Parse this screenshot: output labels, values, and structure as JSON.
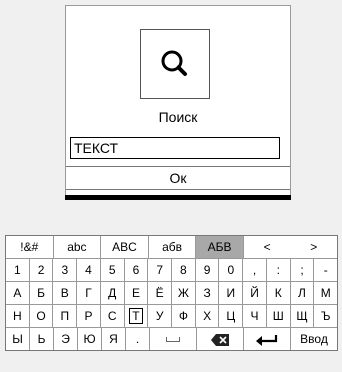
{
  "dialog": {
    "title": "Поиск",
    "input_value": "ТЕКСТ",
    "ok_label": "Ок",
    "icon": "search-icon"
  },
  "keyboard": {
    "modes": [
      "!&#",
      "abc",
      "ABC",
      "абв",
      "АБВ",
      "<",
      ">"
    ],
    "active_mode": "АБВ",
    "row1": [
      "1",
      "2",
      "3",
      "4",
      "5",
      "6",
      "7",
      "8",
      "9",
      "0",
      ",",
      ":",
      ";",
      "-"
    ],
    "row2": [
      "А",
      "Б",
      "В",
      "Г",
      "Д",
      "Е",
      "Ё",
      "Ж",
      "З",
      "И",
      "Й",
      "К",
      "Л",
      "М"
    ],
    "row3": [
      "Н",
      "О",
      "П",
      "Р",
      "С",
      "Т",
      "У",
      "Ф",
      "Х",
      "Ц",
      "Ч",
      "Ш",
      "Щ",
      "Ъ"
    ],
    "row4": [
      "Ы",
      "Ь",
      "Э",
      "Ю",
      "Я",
      "."
    ],
    "enter_label": "Ввод",
    "selected_key": "Т"
  }
}
